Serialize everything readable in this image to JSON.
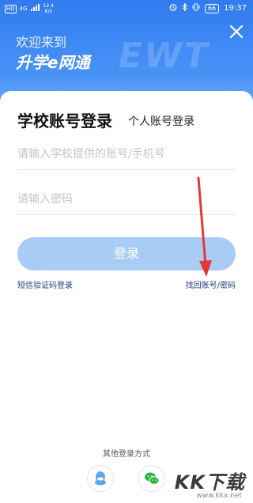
{
  "status_bar": {
    "hd": "HD",
    "signal": "4G",
    "speed_value": "12.4",
    "speed_unit": "K/s",
    "time": "19:37",
    "battery": "66"
  },
  "header": {
    "welcome": "欢迎来到",
    "brand": "升学e网通",
    "logo_text": "EWT"
  },
  "tabs": {
    "school": "学校账号登录",
    "personal": "个人账号登录"
  },
  "form": {
    "account_placeholder": "请输入学校提供的账号/手机号",
    "password_placeholder": "请输入密码",
    "login_label": "登录"
  },
  "links": {
    "sms_login": "短信验证码登录",
    "forgot": "找回账号/密码"
  },
  "other_login": {
    "title": "其他登录方式"
  },
  "site_watermark": {
    "main": "KK下载",
    "url": "www.kkx.net"
  },
  "colors": {
    "header_blue": "#2f7bf0",
    "button_light_blue": "#a9ccf6",
    "annotation_arrow": "#e53935",
    "wechat_green": "#2ab541",
    "qq_blue": "#5aa8f0"
  }
}
